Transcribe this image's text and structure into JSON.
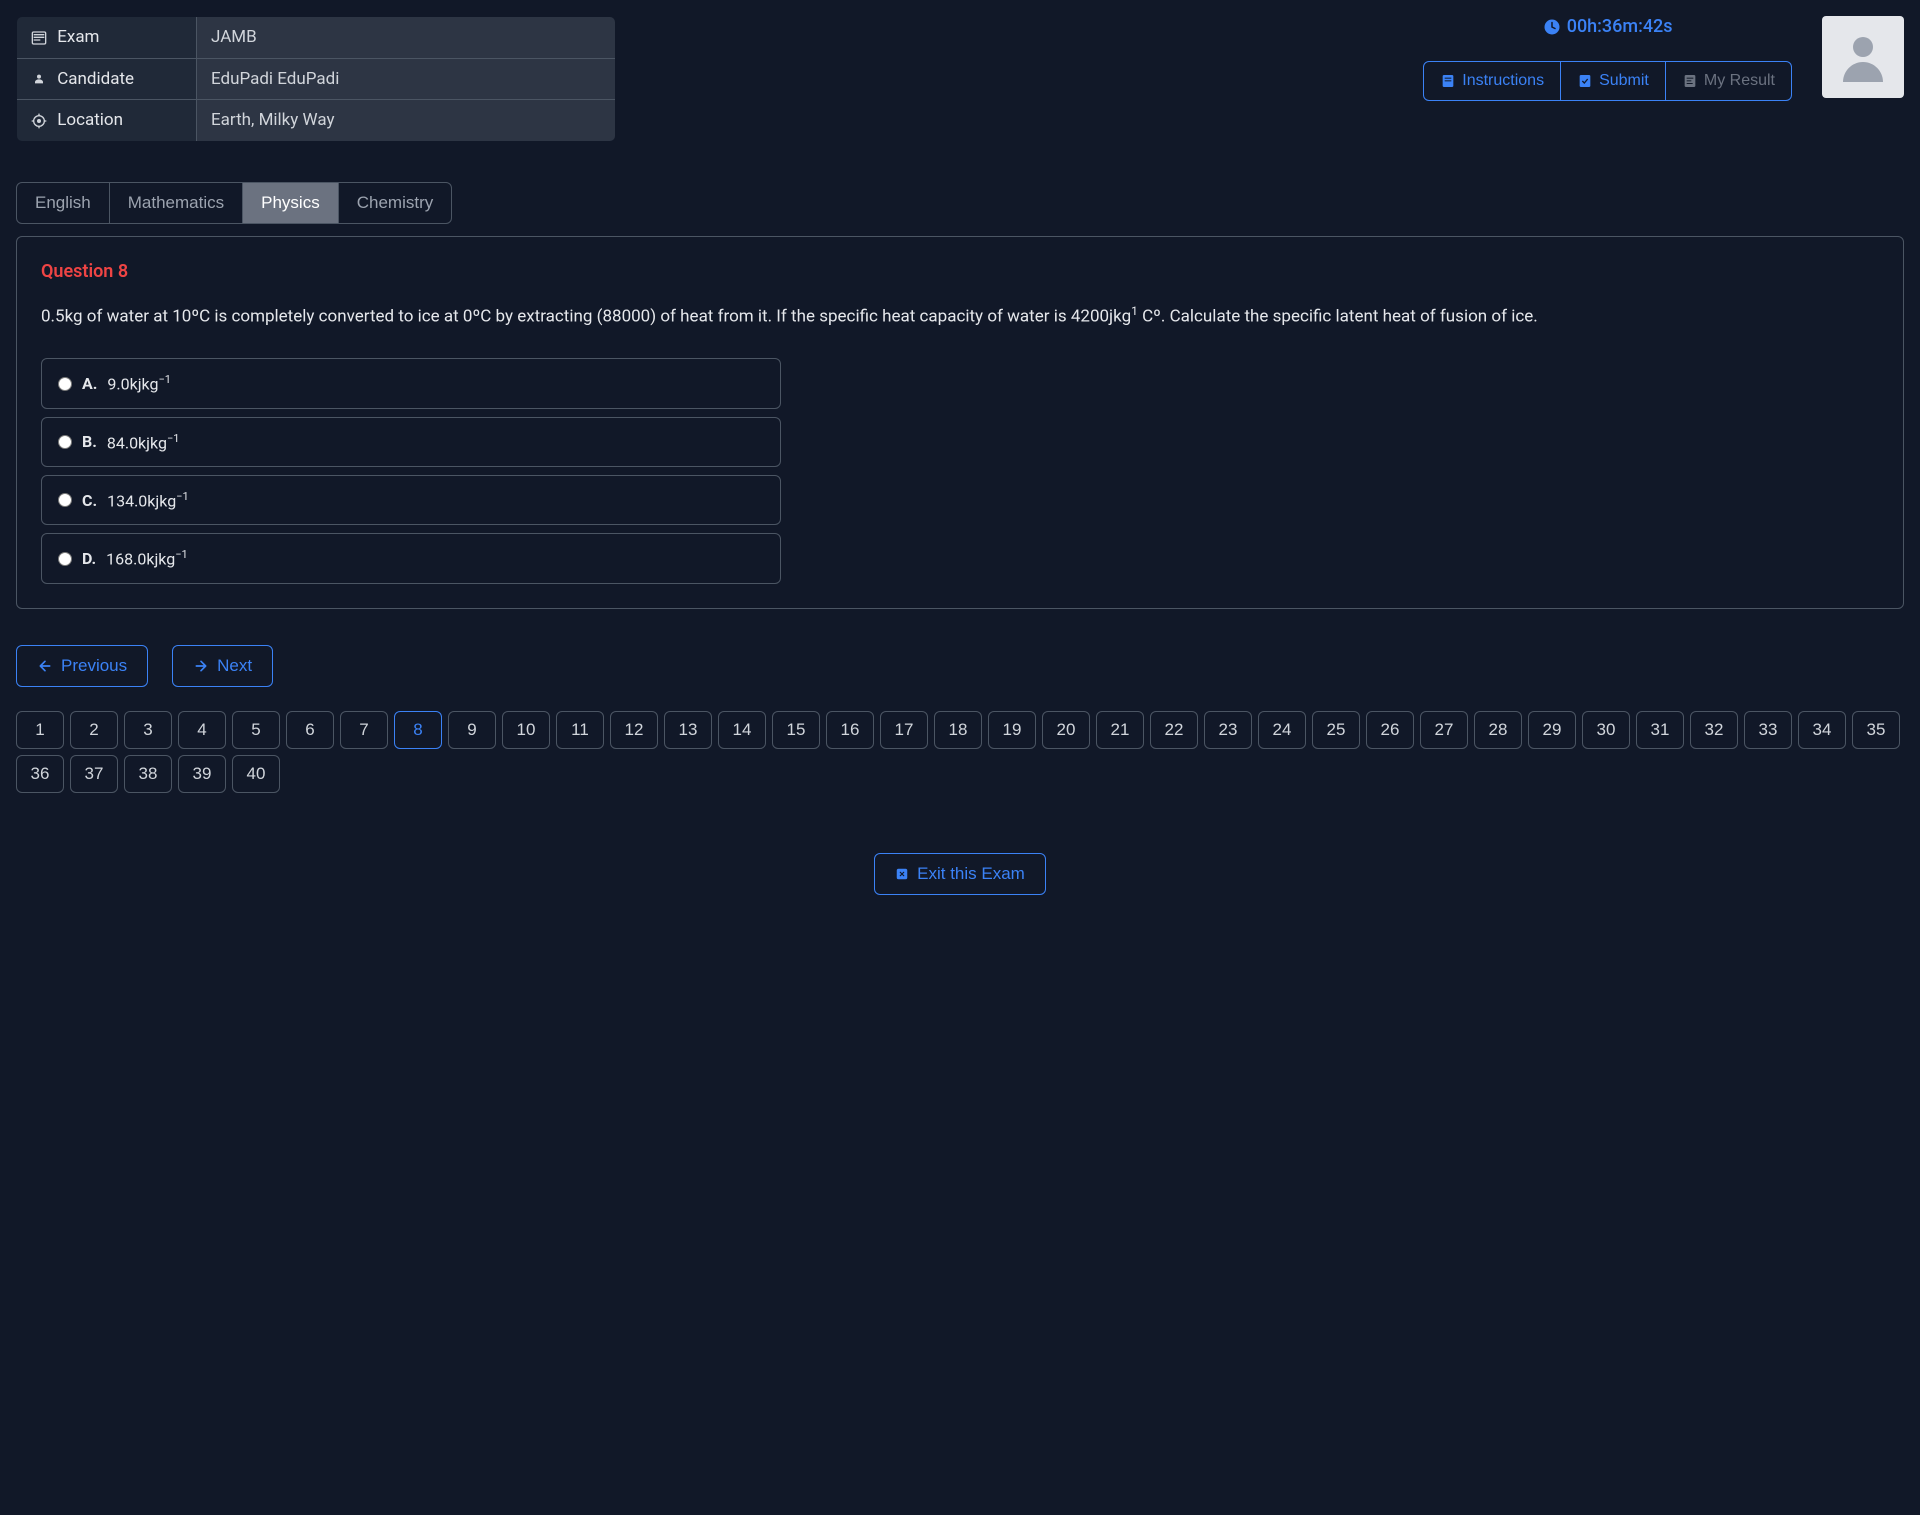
{
  "info": {
    "exam_label": "Exam",
    "exam_value": "JAMB",
    "candidate_label": "Candidate",
    "candidate_value": "EduPadi EduPadi",
    "location_label": "Location",
    "location_value": "Earth, Milky Way"
  },
  "timer": "00h:36m:42s",
  "actions": {
    "instructions": "Instructions",
    "submit": "Submit",
    "my_result": "My Result"
  },
  "tabs": [
    {
      "label": "English",
      "active": false
    },
    {
      "label": "Mathematics",
      "active": false
    },
    {
      "label": "Physics",
      "active": true
    },
    {
      "label": "Chemistry",
      "active": false
    }
  ],
  "question": {
    "number_label": "Question 8",
    "text_before_sup": "0.5kg of water at 10ºC is completely converted to ice at 0ºC by extracting (88000) of heat from it. If the specific heat capacity of water is 4200jkg",
    "text_sup": "1",
    "text_after_sup": " Cº. Calculate the specific latent heat of fusion of ice.",
    "options": [
      {
        "letter": "A.",
        "value": "9.0kjkg",
        "sup": "−1"
      },
      {
        "letter": "B.",
        "value": "84.0kjkg",
        "sup": "−1"
      },
      {
        "letter": "C.",
        "value": "134.0kjkg",
        "sup": "−1"
      },
      {
        "letter": "D.",
        "value": "168.0kjkg",
        "sup": "−1"
      }
    ]
  },
  "nav": {
    "previous": "Previous",
    "next": "Next"
  },
  "question_numbers": {
    "total": 40,
    "current": 8
  },
  "exit_label": "Exit this Exam"
}
